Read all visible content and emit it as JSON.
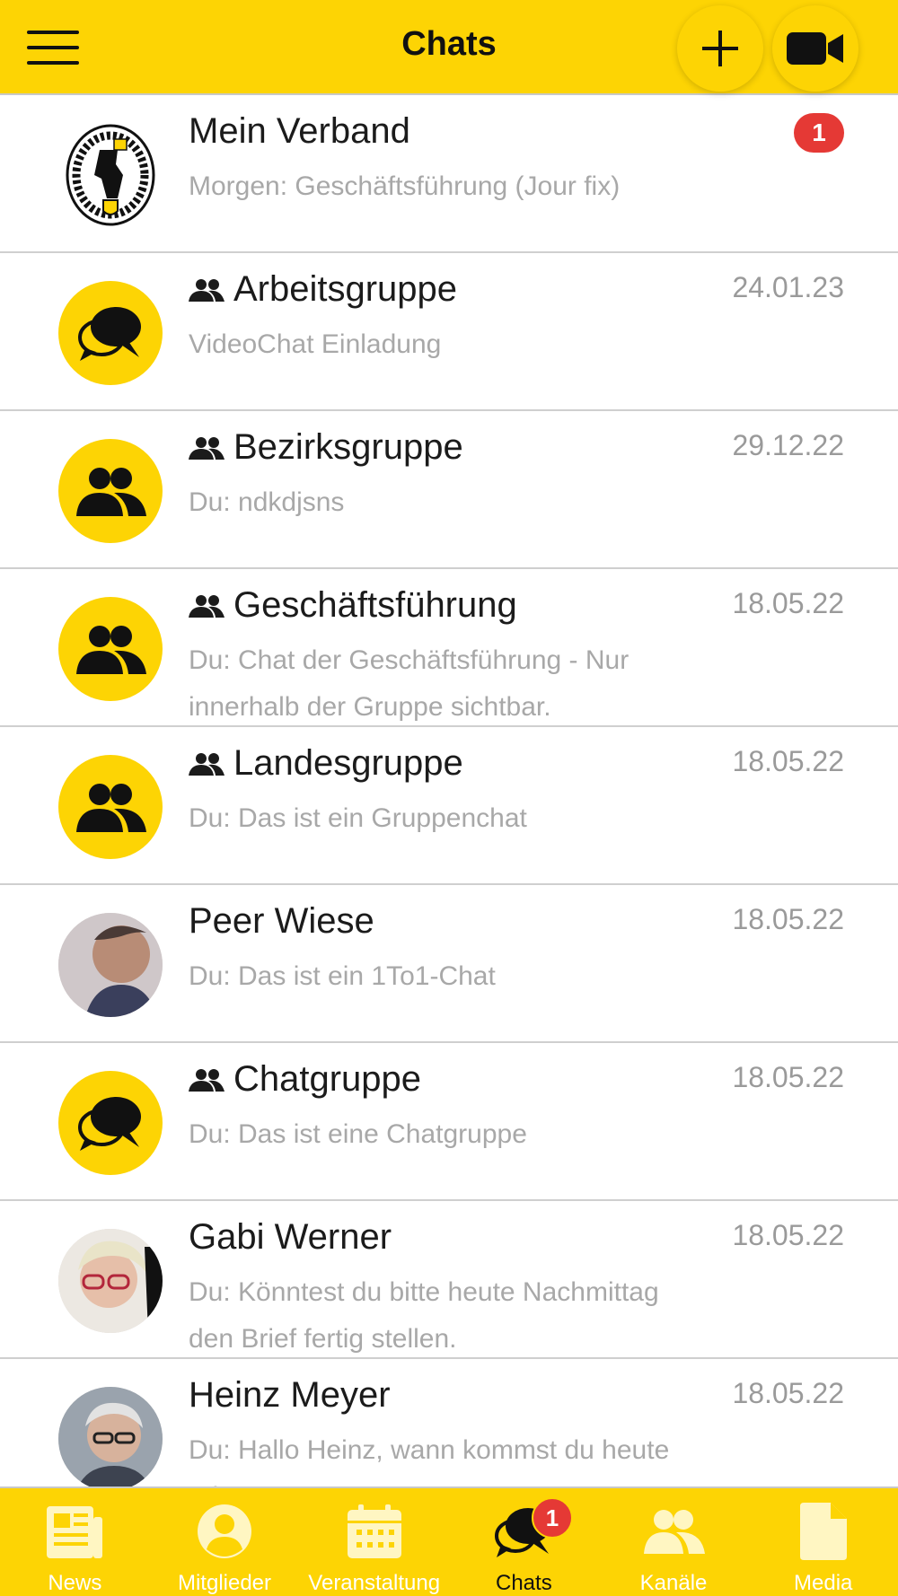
{
  "header": {
    "title": "Chats",
    "menu_icon": "hamburger-menu-icon",
    "add_icon": "plus-icon",
    "video_icon": "video-camera-icon",
    "bg_color": "#FDD404"
  },
  "chats": [
    {
      "name": "Mein Verband",
      "preview": "Morgen: Geschäftsführung (Jour fix)",
      "date": "",
      "badge": "1",
      "group": false,
      "avatar": "crest"
    },
    {
      "name": "Arbeitsgruppe",
      "preview": "VideoChat Einladung",
      "date": "24.01.23",
      "badge": "",
      "group": true,
      "avatar": "chat-bubbles-icon"
    },
    {
      "name": "Bezirksgruppe",
      "preview": "Du: ndkdjsns",
      "date": "29.12.22",
      "badge": "",
      "group": true,
      "avatar": "people-icon"
    },
    {
      "name": "Geschäftsführung",
      "preview": "Du: Chat der Geschäftsführung - Nur innerhalb der Gruppe sichtbar.",
      "date": "18.05.22",
      "badge": "",
      "group": true,
      "avatar": "people-icon"
    },
    {
      "name": "Landesgruppe",
      "preview": "Du: Das ist ein Gruppenchat",
      "date": "18.05.22",
      "badge": "",
      "group": true,
      "avatar": "people-icon"
    },
    {
      "name": "Peer Wiese",
      "preview": "Du: Das ist ein 1To1-Chat",
      "date": "18.05.22",
      "badge": "",
      "group": false,
      "avatar": "photo"
    },
    {
      "name": "Chatgruppe",
      "preview": "Du: Das ist eine Chatgruppe",
      "date": "18.05.22",
      "badge": "",
      "group": true,
      "avatar": "chat-bubbles-icon"
    },
    {
      "name": "Gabi Werner",
      "preview": "Du: Könntest du bitte heute Nachmittag den Brief fertig stellen.",
      "date": "18.05.22",
      "badge": "",
      "group": false,
      "avatar": "photo"
    },
    {
      "name": "Heinz Meyer",
      "preview": "Du: Hallo Heinz, wann kommst du heute rein?",
      "date": "18.05.22",
      "badge": "",
      "group": false,
      "avatar": "photo"
    }
  ],
  "nav": {
    "items": [
      {
        "label": "News",
        "icon": "newspaper-icon"
      },
      {
        "label": "Mitglieder",
        "icon": "user-circle-icon"
      },
      {
        "label": "Veranstaltung",
        "icon": "calendar-icon"
      },
      {
        "label": "Chats",
        "icon": "chat-bubbles-icon",
        "badge": "1",
        "active": true
      },
      {
        "label": "Kanäle",
        "icon": "people-icon"
      },
      {
        "label": "Media",
        "icon": "document-icon"
      }
    ]
  },
  "colors": {
    "accent": "#FDD404",
    "badge": "#E53935",
    "muted_text": "#A8A8A8"
  }
}
